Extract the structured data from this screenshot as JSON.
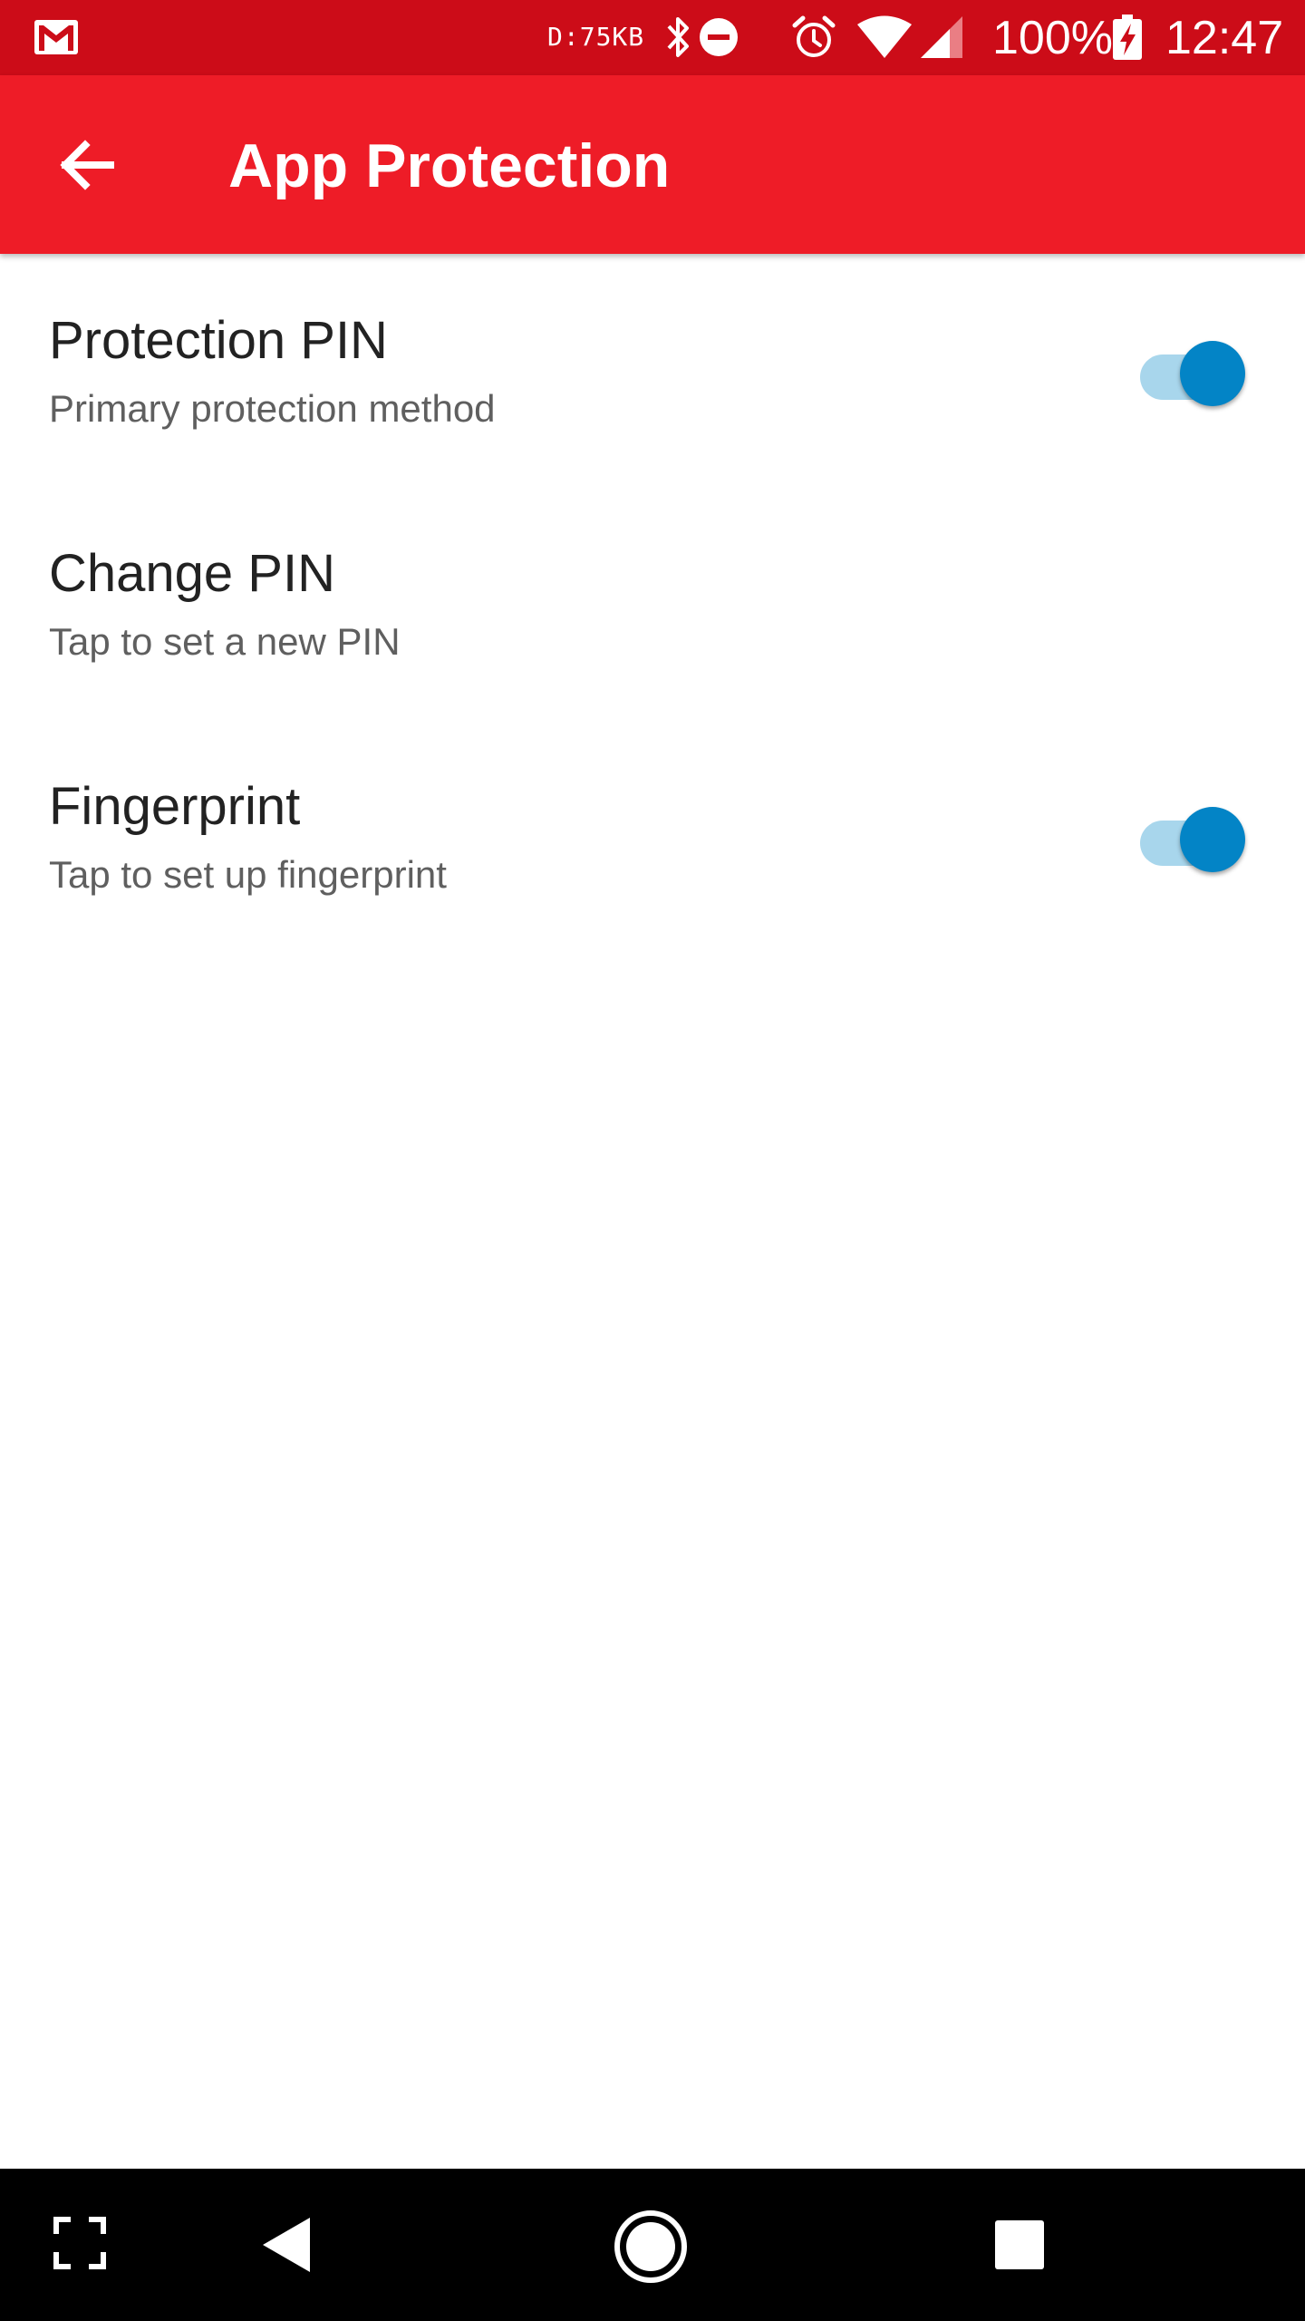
{
  "status_bar": {
    "net_speed": "D:75KB",
    "battery_percent": "100%",
    "time": "12:47",
    "icons": [
      "gmail-icon",
      "bluetooth-icon",
      "do-not-disturb-icon",
      "alarm-icon",
      "wifi-icon",
      "cell-signal-icon",
      "battery-charging-icon"
    ]
  },
  "app_bar": {
    "title": "App Protection",
    "back_icon": "arrow-back-icon"
  },
  "settings": {
    "protection_pin": {
      "label": "Protection PIN",
      "description": "Primary protection method",
      "enabled": true
    },
    "change_pin": {
      "label": "Change PIN",
      "description": "Tap to set a new PIN"
    },
    "fingerprint": {
      "label": "Fingerprint",
      "description": "Tap to set up fingerprint",
      "enabled": true
    }
  },
  "nav_bar": {
    "icons": [
      "screenshot-frame-icon",
      "back-triangle-icon",
      "home-circle-icon",
      "recents-square-icon"
    ]
  },
  "colors": {
    "status_bar": "#cc0c18",
    "app_bar": "#ee1c27",
    "switch_thumb": "#0384c6",
    "switch_track": "#a8d6ec"
  }
}
